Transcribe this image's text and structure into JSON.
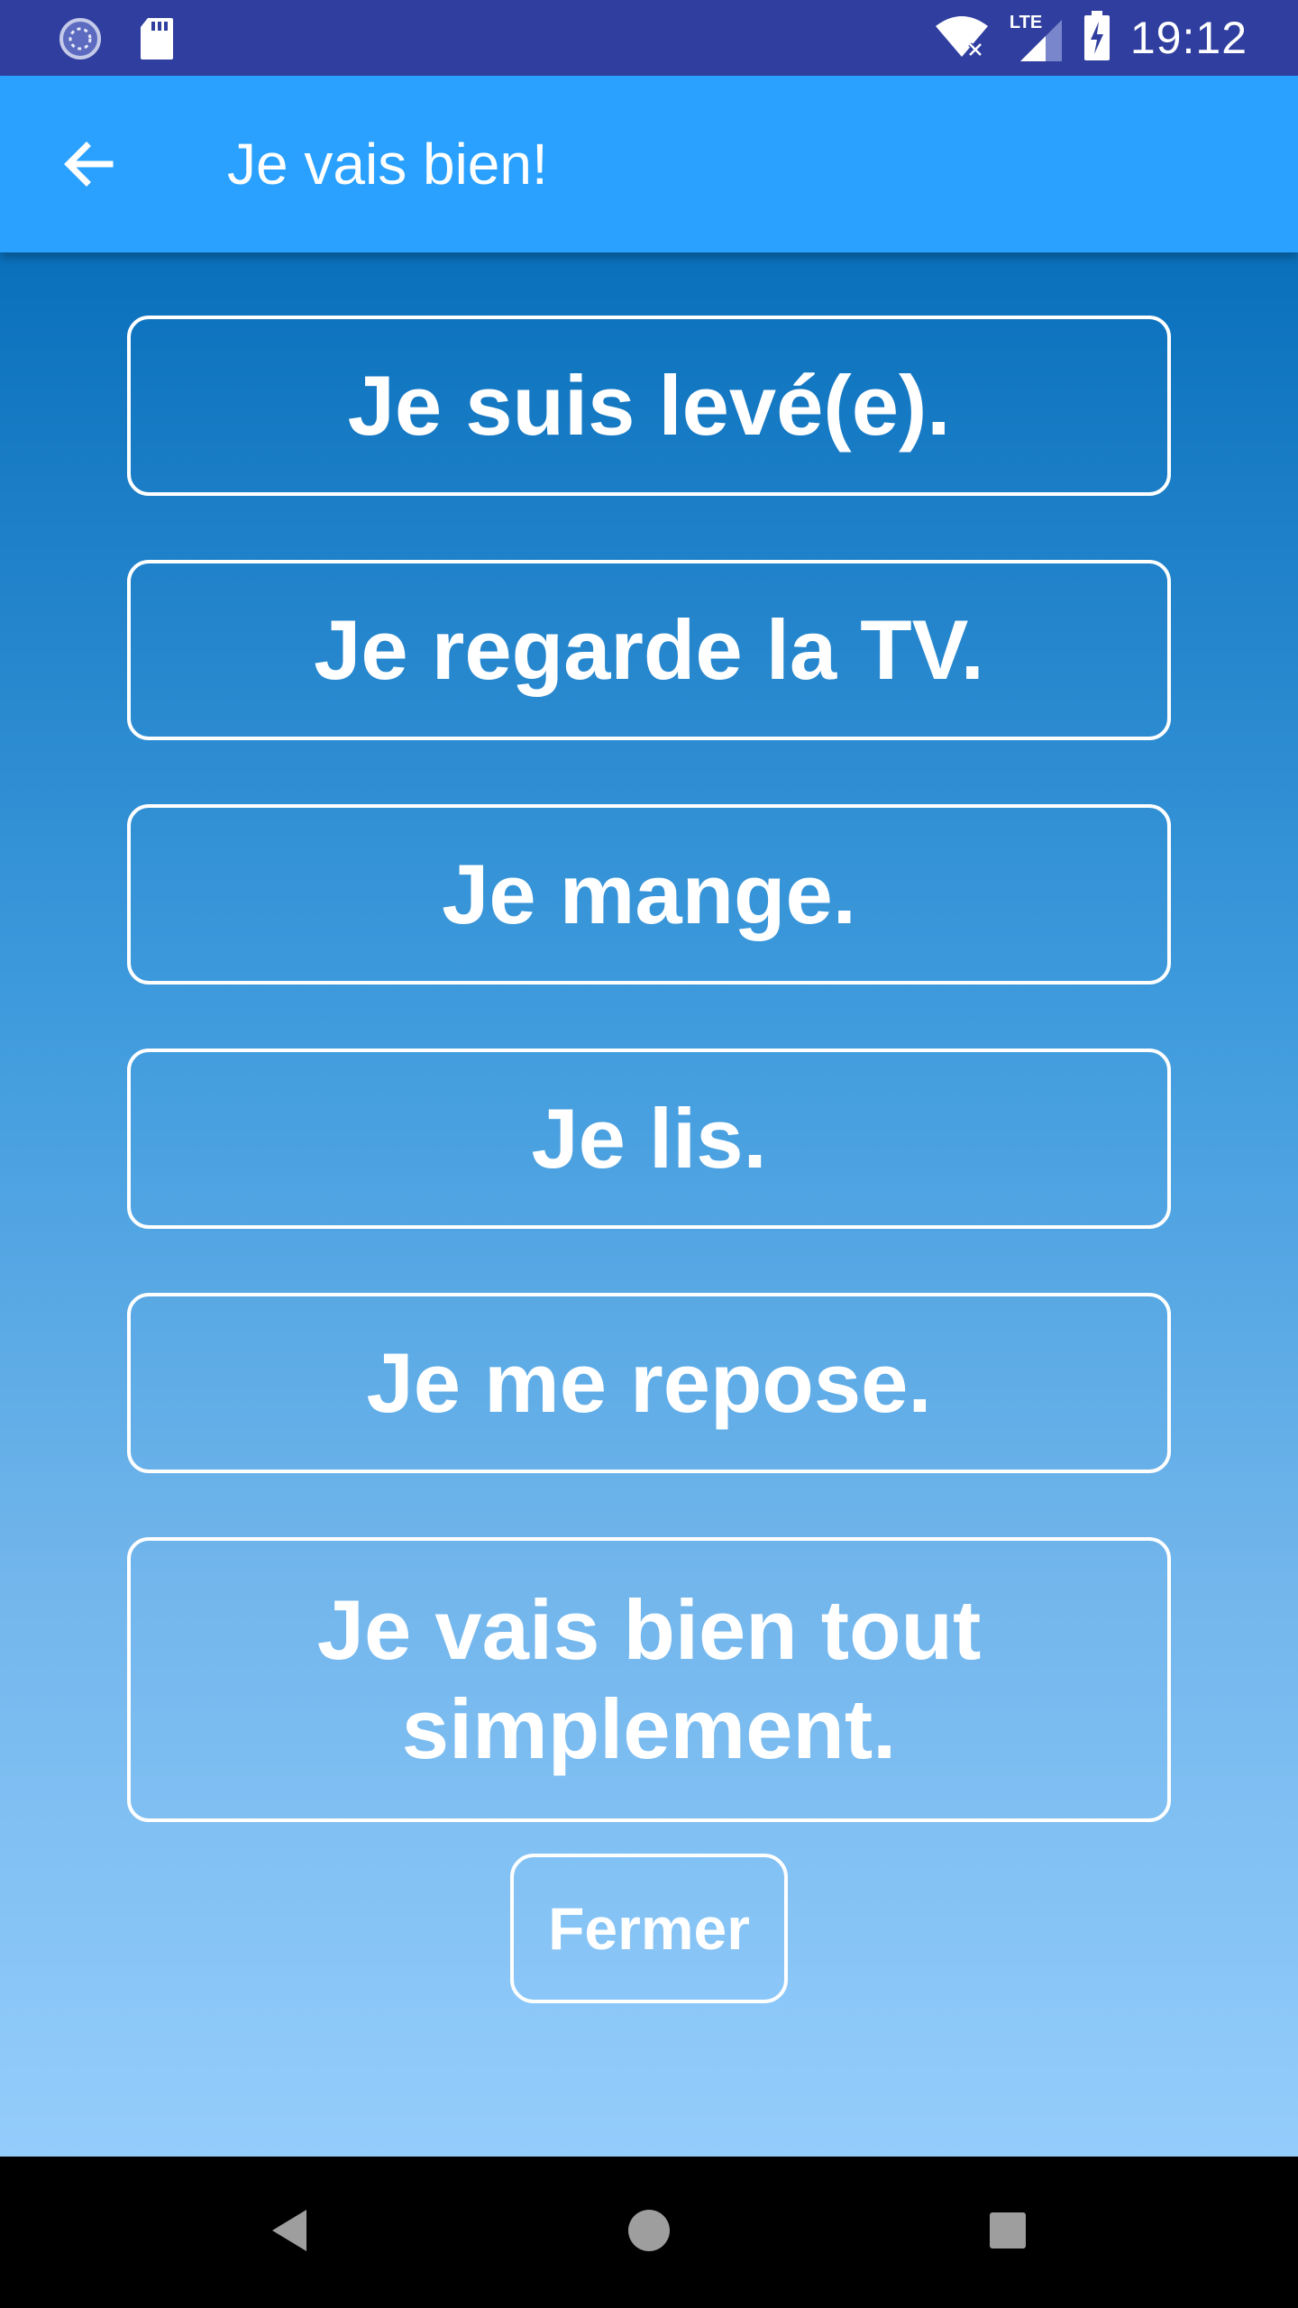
{
  "status_bar": {
    "time": "19:12",
    "network_label": "LTE",
    "icons": [
      "sync-icon",
      "sd-card-icon",
      "wifi-icon",
      "cell-signal-icon",
      "battery-charging-icon"
    ]
  },
  "app_bar": {
    "title": "Je vais bien!",
    "back_icon": "arrow-back-icon"
  },
  "choices": [
    {
      "label": "Je suis levé(e)."
    },
    {
      "label": "Je regarde la TV."
    },
    {
      "label": "Je mange."
    },
    {
      "label": "Je lis."
    },
    {
      "label": "Je me repose."
    },
    {
      "label": "Je vais bien tout simplement."
    }
  ],
  "close_button": {
    "label": "Fermer"
  },
  "nav_bar": {
    "icons": [
      "nav-back-icon",
      "nav-home-icon",
      "nav-recents-icon"
    ]
  },
  "colors": {
    "status_bar": "#303F9F",
    "app_bar": "#2AA1FF",
    "gradient_top": "#0A70BC",
    "gradient_bottom": "#94CDFC",
    "button_border": "#FFFFFF"
  }
}
